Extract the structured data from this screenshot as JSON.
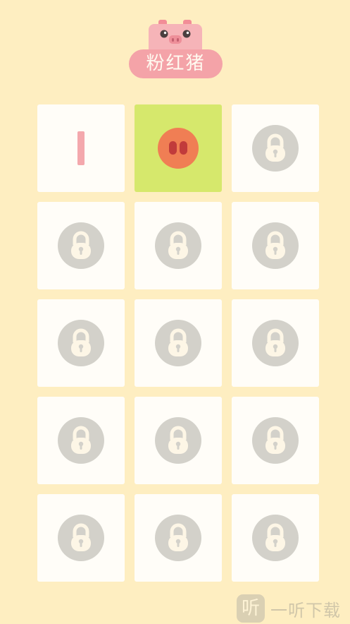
{
  "header": {
    "title": "粉红猪",
    "mascot_icon": "pig-face-icon"
  },
  "colors": {
    "background": "#feeec1",
    "tile": "#fffdf8",
    "active_tile": "#d6e86c",
    "lock_circle": "#d3d1ca",
    "accent_pink": "#f4a3a8",
    "snout": "#f07e54"
  },
  "tiles": [
    {
      "state": "unlocked",
      "icon": "bar-icon"
    },
    {
      "state": "selected",
      "icon": "pig-snout-icon"
    },
    {
      "state": "locked",
      "icon": "lock-icon"
    },
    {
      "state": "locked",
      "icon": "lock-icon"
    },
    {
      "state": "locked",
      "icon": "lock-icon"
    },
    {
      "state": "locked",
      "icon": "lock-icon"
    },
    {
      "state": "locked",
      "icon": "lock-icon"
    },
    {
      "state": "locked",
      "icon": "lock-icon"
    },
    {
      "state": "locked",
      "icon": "lock-icon"
    },
    {
      "state": "locked",
      "icon": "lock-icon"
    },
    {
      "state": "locked",
      "icon": "lock-icon"
    },
    {
      "state": "locked",
      "icon": "lock-icon"
    },
    {
      "state": "locked",
      "icon": "lock-icon"
    },
    {
      "state": "locked",
      "icon": "lock-icon"
    },
    {
      "state": "locked",
      "icon": "lock-icon"
    }
  ],
  "watermark": {
    "icon_text": "听",
    "text": "一听下载"
  }
}
